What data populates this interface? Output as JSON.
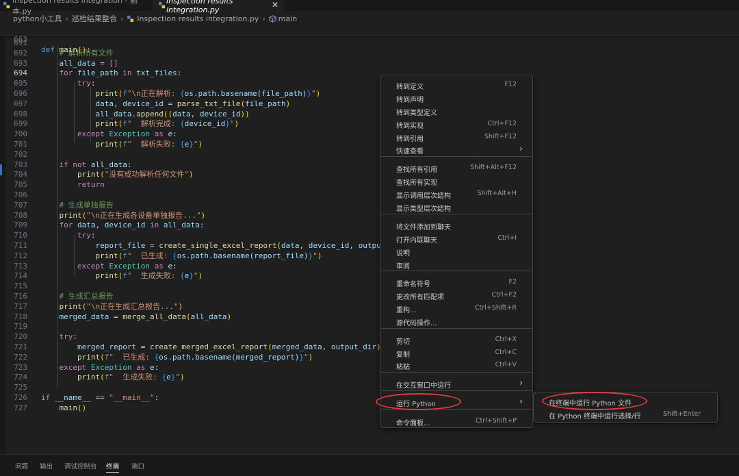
{
  "tabs": [
    {
      "label": "Inspection results integration - 副本.py",
      "active": false
    },
    {
      "label": "Inspection results integration.py",
      "active": true
    }
  ],
  "tab_close": "✕",
  "breadcrumb": {
    "folder1": "python小工具",
    "folder2": "巡检结果整合",
    "file": "Inspection results integration.py",
    "symbol": "main"
  },
  "sticky": {
    "line": "663",
    "code": "def main():"
  },
  "editor_lines": [
    {
      "n": "691",
      "code": ""
    },
    {
      "n": "692",
      "code": "    # 解析所有文件"
    },
    {
      "n": "693",
      "code": "    all_data = []"
    },
    {
      "n": "694",
      "code": "    for file_path in txt_files:"
    },
    {
      "n": "695",
      "code": "        try:"
    },
    {
      "n": "696",
      "code": "            print(f\"\\n正在解析: {os.path.basename(file_path)}\")"
    },
    {
      "n": "697",
      "code": "            data, device_id = parse_txt_file(file_path)"
    },
    {
      "n": "698",
      "code": "            all_data.append((data, device_id))"
    },
    {
      "n": "699",
      "code": "            print(f\"  解析完成: {device_id}\")"
    },
    {
      "n": "700",
      "code": "        except Exception as e:"
    },
    {
      "n": "701",
      "code": "            print(f\"  解析失败: {e}\")"
    },
    {
      "n": "702",
      "code": ""
    },
    {
      "n": "703",
      "code": "    if not all_data:"
    },
    {
      "n": "704",
      "code": "        print(\"没有成功解析任何文件\")"
    },
    {
      "n": "705",
      "code": "        return"
    },
    {
      "n": "706",
      "code": ""
    },
    {
      "n": "707",
      "code": "    # 生成单独报告"
    },
    {
      "n": "708",
      "code": "    print(\"\\n正在生成各设备单独报告...\")"
    },
    {
      "n": "709",
      "code": "    for data, device_id in all_data:"
    },
    {
      "n": "710",
      "code": "        try:"
    },
    {
      "n": "711",
      "code": "            report_file = create_single_excel_report(data, device_id, output_dir)"
    },
    {
      "n": "712",
      "code": "            print(f\"  已生成: {os.path.basename(report_file)}\")"
    },
    {
      "n": "713",
      "code": "        except Exception as e:"
    },
    {
      "n": "714",
      "code": "            print(f\"  生成失败: {e}\")"
    },
    {
      "n": "715",
      "code": ""
    },
    {
      "n": "716",
      "code": "    # 生成汇总报告"
    },
    {
      "n": "717",
      "code": "    print(\"\\n正在生成汇总报告...\")"
    },
    {
      "n": "718",
      "code": "    merged_data = merge_all_data(all_data)"
    },
    {
      "n": "719",
      "code": ""
    },
    {
      "n": "720",
      "code": "    try:"
    },
    {
      "n": "721",
      "code": "        merged_report = create_merged_excel_report(merged_data, output_dir)"
    },
    {
      "n": "722",
      "code": "        print(f\"  已生成: {os.path.basename(merged_report)}\")"
    },
    {
      "n": "723",
      "code": "    except Exception as e:"
    },
    {
      "n": "724",
      "code": "        print(f\"  生成失败: {e}\")"
    },
    {
      "n": "725",
      "code": ""
    },
    {
      "n": "726",
      "code": "if __name__ == \"__main__\":"
    },
    {
      "n": "727",
      "code": "    main()"
    }
  ],
  "context_menu": {
    "items": [
      {
        "label": "转到定义",
        "key": "F12"
      },
      {
        "label": "转到声明",
        "key": ""
      },
      {
        "label": "转到类型定义",
        "key": ""
      },
      {
        "label": "转到实现",
        "key": "Ctrl+F12"
      },
      {
        "label": "转到引用",
        "key": "Shift+F12"
      },
      {
        "label": "快速查看",
        "key": "",
        "submenu": true
      },
      {
        "label": "查找所有引用",
        "key": "Shift+Alt+F12"
      },
      {
        "label": "查找所有实现",
        "key": ""
      },
      {
        "label": "显示调用层次结构",
        "key": "Shift+Alt+H"
      },
      {
        "label": "显示类型层次结构",
        "key": ""
      },
      {
        "label": "将文件添加到聊天",
        "key": ""
      },
      {
        "label": "打开内联聊天",
        "key": "Ctrl+I"
      },
      {
        "label": "说明",
        "key": ""
      },
      {
        "label": "审阅",
        "key": ""
      },
      {
        "label": "重命名符号",
        "key": "F2"
      },
      {
        "label": "更改所有匹配项",
        "key": "Ctrl+F2"
      },
      {
        "label": "重构...",
        "key": "Ctrl+Shift+R"
      },
      {
        "label": "源代码操作...",
        "key": ""
      },
      {
        "label": "剪切",
        "key": "Ctrl+X"
      },
      {
        "label": "复制",
        "key": "Ctrl+C"
      },
      {
        "label": "粘贴",
        "key": "Ctrl+V"
      },
      {
        "label": "在交互窗口中运行",
        "key": "",
        "submenu": true
      },
      {
        "label": "运行 Python",
        "key": "",
        "submenu": true
      },
      {
        "label": "命令面板...",
        "key": "Ctrl+Shift+P"
      }
    ],
    "arrow": "›"
  },
  "submenu": {
    "items": [
      {
        "label": "在终端中运行 Python 文件",
        "key": ""
      },
      {
        "label": "在 Python 终端中运行选择/行",
        "key": "Shift+Enter"
      }
    ]
  },
  "panel": {
    "tabs": [
      "问题",
      "输出",
      "调试控制台",
      "终端",
      "端口"
    ],
    "active": "终端"
  },
  "colors": {
    "highlight_oval": "#e03a3a",
    "keyword": "#c586c0",
    "string": "#ce9178",
    "comment": "#6a9955"
  }
}
